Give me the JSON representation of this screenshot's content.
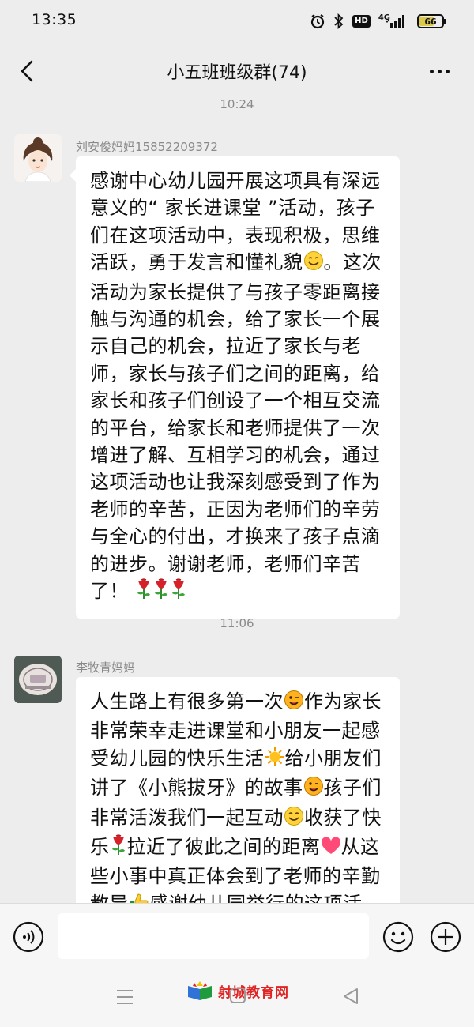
{
  "status_bar": {
    "time": "13:35",
    "network_label": "4G",
    "battery_level": "66",
    "battery_percent": 66
  },
  "header": {
    "title": "小五班班级群(74)",
    "back_icon": "chevron-left-icon",
    "more_icon": "more-dots-icon"
  },
  "messages": [
    {
      "timestamp": "10:24",
      "sender": "刘安俊妈妈15852209372",
      "segments": [
        {
          "t": "感谢中心幼儿园开展这项具有深远意义的“ 家长进课堂 ”活动，孩子们在这项活动中，表现积极，思维活跃，勇于发言和懂礼貌"
        },
        {
          "e": "smile"
        },
        {
          "t": "。这次活动为家长提供了与孩子零距离接触与沟通的机会，给了家长一个展示自己的机会，拉近了家长与老师，家长与孩子们之间的距离，给家长和孩子们创设了一个相互交流的平台，给家长和老师提供了一次增进了解、互相学习的机会，通过这项活动也让我深刻感受到了作为老师的辛苦，正因为老师们的辛劳与全心的付出，才换来了孩子点滴的进步。谢谢老师，老师们辛苦了！ "
        },
        {
          "e": "rose"
        },
        {
          "e": "rose"
        },
        {
          "e": "rose"
        }
      ]
    },
    {
      "timestamp": "11:06",
      "sender": "李牧青妈妈",
      "segments": [
        {
          "t": "人生路上有很多第一次"
        },
        {
          "e": "wink"
        },
        {
          "t": "作为家长非常荣幸走进课堂和小朋友一起感受幼儿园的快乐生活"
        },
        {
          "e": "sun"
        },
        {
          "t": "给小朋友们讲了《小熊拔牙》的故事"
        },
        {
          "e": "wink"
        },
        {
          "t": "孩子们非常活泼我们一起互动"
        },
        {
          "e": "smile"
        },
        {
          "t": "收获了快乐"
        },
        {
          "e": "rose"
        },
        {
          "t": "拉近了彼此之间的距离"
        },
        {
          "e": "heart"
        },
        {
          "t": "从这些小事中真正体会到了老师的辛勤教导"
        },
        {
          "e": "thumbs"
        },
        {
          "t": "感谢幼儿园举行的这项活"
        }
      ]
    }
  ],
  "input_bar": {
    "placeholder": "",
    "voice_icon": "voice-icon",
    "emoji_icon": "emoji-icon",
    "plus_icon": "plus-circle-icon"
  },
  "nav_bar": {
    "menu_icon": "menu-icon",
    "home_icon": "home-square-icon",
    "back_icon": "back-triangle-icon"
  },
  "watermark": {
    "text": "射城教育网"
  },
  "colors": {
    "background": "#ededed",
    "bubble": "#ffffff",
    "meta_text": "#8a8a8a",
    "watermark": "#e02323"
  }
}
